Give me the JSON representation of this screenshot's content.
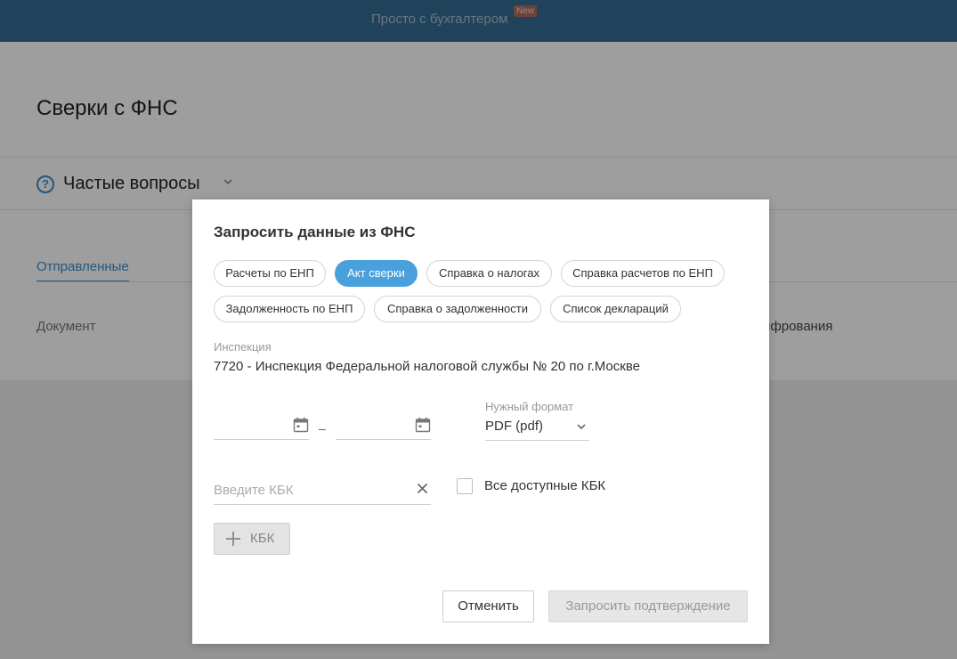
{
  "topbar": {
    "title": "Просто с бухгалтером",
    "badge": "New"
  },
  "page": {
    "title": "Сверки с ФНС",
    "faq_label": "Частые вопросы",
    "tab_sent": "Отправленные",
    "col_document": "Документ",
    "col_encryption_partial": "ифрования"
  },
  "modal": {
    "title": "Запросить данные из ФНС",
    "request_types": [
      {
        "label": "Расчеты по ЕНП",
        "active": false
      },
      {
        "label": "Акт сверки",
        "active": true
      },
      {
        "label": "Справка о налогах",
        "active": false
      },
      {
        "label": "Справка расчетов по ЕНП",
        "active": false
      },
      {
        "label": "Задолженность по ЕНП",
        "active": false
      },
      {
        "label": "Справка о задолженности",
        "active": false
      },
      {
        "label": "Список деклараций",
        "active": false
      }
    ],
    "inspection_label": "Инспекция",
    "inspection_value": "7720 - Инспекция Федеральной налоговой службы № 20 по г.Москве",
    "date_from": "",
    "date_separator": "–",
    "date_to": "",
    "format_label": "Нужный формат",
    "format_value": "PDF (pdf)",
    "kbk_placeholder": "Введите КБК",
    "kbk_value": "",
    "all_kbk_label": "Все доступные КБК",
    "all_kbk_checked": false,
    "add_kbk_label": "КБК",
    "cancel_label": "Отменить",
    "request_label": "Запросить подтверждение"
  },
  "colors": {
    "accent": "#4aa0dc",
    "topbar": "#356d94",
    "link": "#3c8bc9"
  }
}
